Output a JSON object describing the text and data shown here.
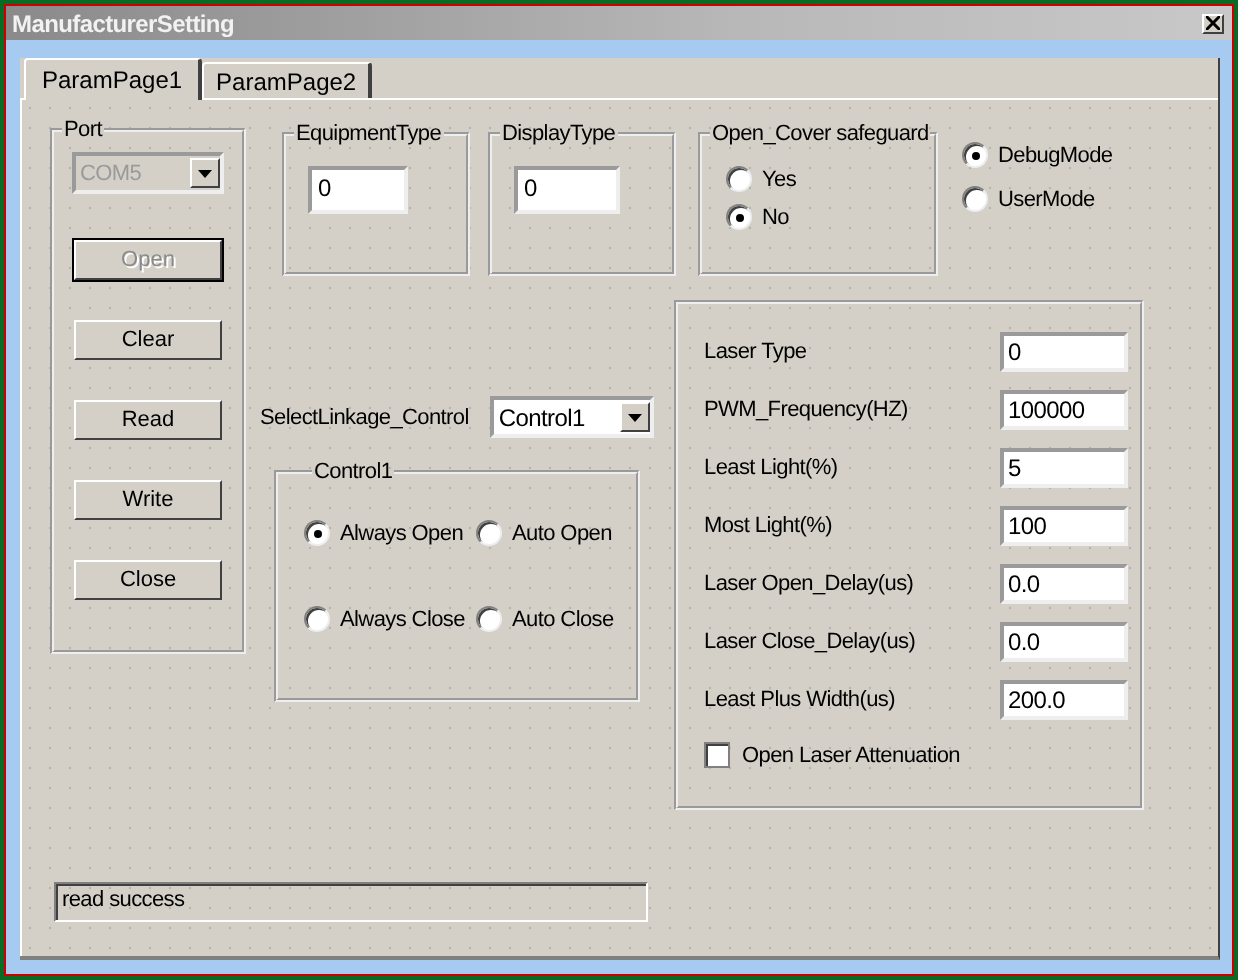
{
  "window": {
    "title": "ManufacturerSetting"
  },
  "tabs": [
    {
      "label": "ParamPage1",
      "selected": true
    },
    {
      "label": "ParamPage2",
      "selected": false
    }
  ],
  "port": {
    "label": "Port",
    "combo": {
      "value": "COM5",
      "disabled": true
    },
    "buttons": [
      {
        "label": "Open",
        "disabled": true
      },
      {
        "label": "Clear",
        "disabled": false
      },
      {
        "label": "Read",
        "disabled": false
      },
      {
        "label": "Write",
        "disabled": false
      },
      {
        "label": "Close",
        "disabled": false
      }
    ]
  },
  "equipment_type": {
    "label": "EquipmentType",
    "value": "0"
  },
  "display_type": {
    "label": "DisplayType",
    "value": "0"
  },
  "open_cover": {
    "label": "Open_Cover safeguard",
    "options": [
      {
        "label": "Yes",
        "selected": false
      },
      {
        "label": "No",
        "selected": true
      }
    ]
  },
  "mode": {
    "options": [
      {
        "label": "DebugMode",
        "selected": true
      },
      {
        "label": "UserMode",
        "selected": false
      }
    ]
  },
  "linkage": {
    "label": "SelectLinkage_Control",
    "value": "Control1"
  },
  "control_group": {
    "label": "Control1",
    "options": [
      {
        "label": "Always Open",
        "selected": true
      },
      {
        "label": "Auto Open",
        "selected": false
      },
      {
        "label": "Always Close",
        "selected": false
      },
      {
        "label": "Auto Close",
        "selected": false
      }
    ]
  },
  "laser": {
    "fields": [
      {
        "label": "Laser Type",
        "value": "0"
      },
      {
        "label": "PWM_Frequency(HZ)",
        "value": "100000"
      },
      {
        "label": "Least Light(%)",
        "value": "5"
      },
      {
        "label": "Most Light(%)",
        "value": "100"
      },
      {
        "label": "Laser Open_Delay(us)",
        "value": "0.0"
      },
      {
        "label": "Laser Close_Delay(us)",
        "value": "0.0"
      },
      {
        "label": "Least Plus Width(us)",
        "value": "200.0"
      }
    ],
    "checkbox": {
      "label": "Open Laser Attenuation",
      "checked": false
    }
  },
  "status": "read success"
}
